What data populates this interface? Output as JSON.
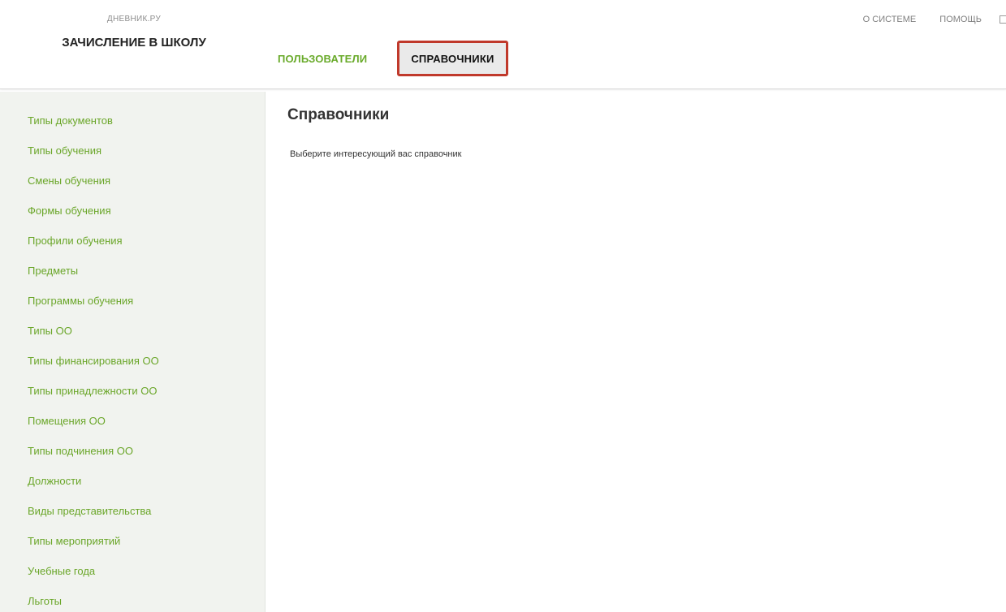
{
  "header": {
    "brand": "ДНЕВНИК.РУ",
    "app_title": "ЗАЧИСЛЕНИЕ В ШКОЛУ",
    "nav": {
      "users": "ПОЛЬЗОВАТЕЛИ",
      "references": "СПРАВОЧНИКИ"
    },
    "top_links": {
      "about": "О СИСТЕМЕ",
      "help": "ПОМОЩЬ"
    },
    "icons": {
      "edge_icon": "mail-icon"
    }
  },
  "sidebar": {
    "items": [
      "Типы документов",
      "Типы обучения",
      "Смены обучения",
      "Формы обучения",
      "Профили обучения",
      "Предметы",
      "Программы обучения",
      "Типы ОО",
      "Типы финансирования ОО",
      "Типы принадлежности ОО",
      "Помещения ОО",
      "Типы подчинения ОО",
      "Должности",
      "Виды представительства",
      "Типы мероприятий",
      "Учебные года",
      "Льготы"
    ]
  },
  "main": {
    "title": "Справочники",
    "subtitle": "Выберите интересующий вас справочник"
  },
  "colors": {
    "accent_green": "#69aa2a",
    "highlight_border": "#c0392b",
    "sidebar_bg": "#f1f3ef"
  }
}
